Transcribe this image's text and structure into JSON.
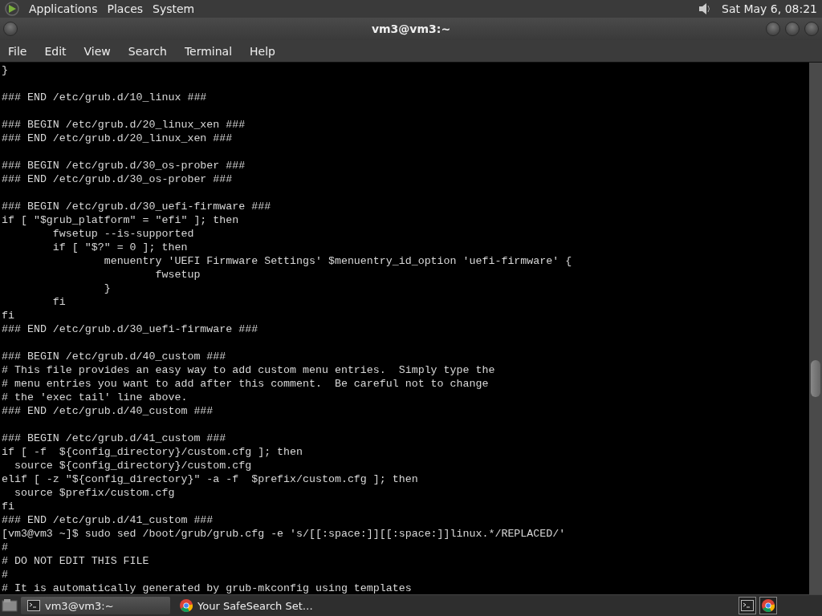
{
  "top_panel": {
    "menus": [
      "Applications",
      "Places",
      "System"
    ],
    "clock": "Sat May  6, 08:21"
  },
  "window": {
    "title": "vm3@vm3:~"
  },
  "menu_bar": [
    "File",
    "Edit",
    "View",
    "Search",
    "Terminal",
    "Help"
  ],
  "terminal": {
    "blocks": [
      [
        "}"
      ],
      [
        "### END /etc/grub.d/10_linux ###"
      ],
      [
        "### BEGIN /etc/grub.d/20_linux_xen ###",
        "### END /etc/grub.d/20_linux_xen ###"
      ],
      [
        "### BEGIN /etc/grub.d/30_os-prober ###",
        "### END /etc/grub.d/30_os-prober ###"
      ],
      [
        "### BEGIN /etc/grub.d/30_uefi-firmware ###",
        "if [ \"$grub_platform\" = \"efi\" ]; then",
        "        fwsetup --is-supported",
        "        if [ \"$?\" = 0 ]; then",
        "                menuentry 'UEFI Firmware Settings' $menuentry_id_option 'uefi-firmware' {",
        "                        fwsetup",
        "                }",
        "        fi",
        "fi",
        "### END /etc/grub.d/30_uefi-firmware ###"
      ],
      [
        "### BEGIN /etc/grub.d/40_custom ###",
        "# This file provides an easy way to add custom menu entries.  Simply type the",
        "# menu entries you want to add after this comment.  Be careful not to change",
        "# the 'exec tail' line above.",
        "### END /etc/grub.d/40_custom ###"
      ],
      [
        "### BEGIN /etc/grub.d/41_custom ###",
        "if [ -f  ${config_directory}/custom.cfg ]; then",
        "  source ${config_directory}/custom.cfg",
        "elif [ -z \"${config_directory}\" -a -f  $prefix/custom.cfg ]; then",
        "  source $prefix/custom.cfg",
        "fi",
        "### END /etc/grub.d/41_custom ###",
        "[vm3@vm3 ~]$ sudo sed /boot/grub/grub.cfg -e 's/[[:space:]][[:space:]]linux.*/REPLACED/'",
        "#",
        "# DO NOT EDIT THIS FILE",
        "#",
        "# It is automatically generated by grub-mkconfig using templates"
      ]
    ]
  },
  "taskbar": {
    "tasks": [
      {
        "label": "vm3@vm3:~",
        "kind": "terminal",
        "selected": true
      },
      {
        "label": "Your SafeSearch Set…",
        "kind": "browser",
        "selected": false
      }
    ],
    "tray": [
      {
        "kind": "terminal"
      },
      {
        "kind": "browser"
      }
    ]
  }
}
